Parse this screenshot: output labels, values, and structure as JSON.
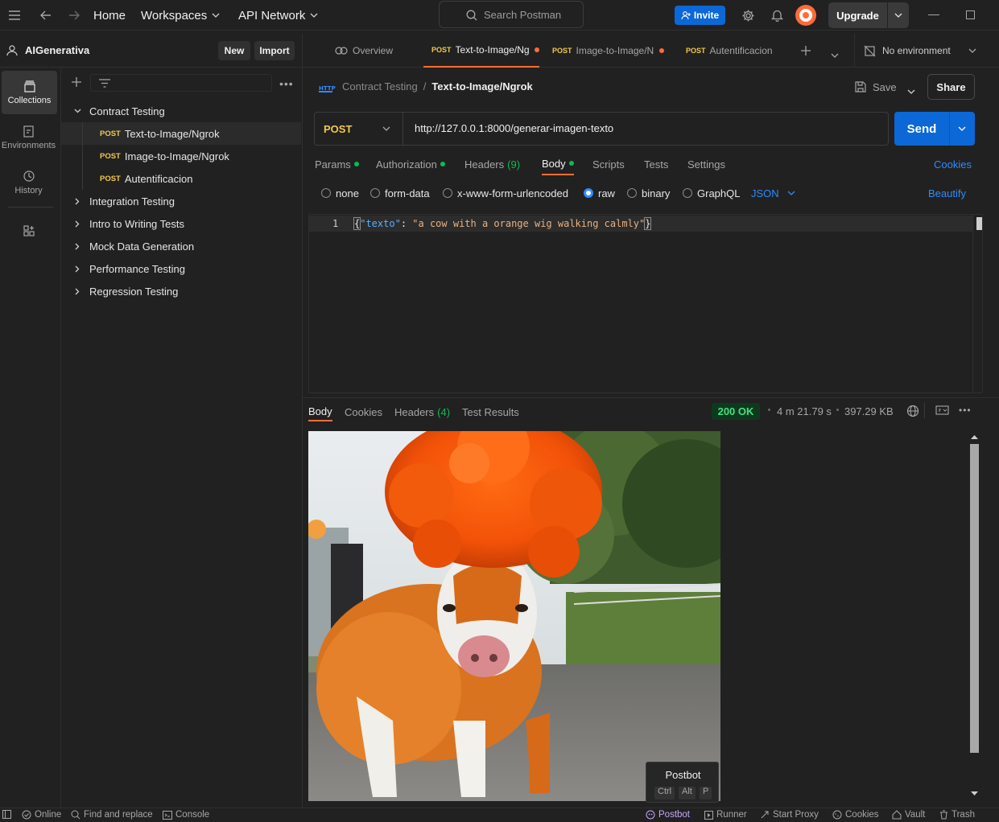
{
  "topbar": {
    "home": "Home",
    "workspaces": "Workspaces",
    "api_network": "API Network",
    "search_placeholder": "Search Postman",
    "invite": "Invite",
    "upgrade": "Upgrade"
  },
  "workspace": {
    "name": "AIGenerativa",
    "new_label": "New",
    "import_label": "Import"
  },
  "rail": {
    "collections": "Collections",
    "environments": "Environments",
    "history": "History"
  },
  "tree": {
    "method": "POST",
    "folders": [
      {
        "label": "Contract Testing",
        "expanded": true
      },
      {
        "label": "Integration Testing"
      },
      {
        "label": "Intro to Writing Tests"
      },
      {
        "label": "Mock Data Generation"
      },
      {
        "label": "Performance Testing"
      },
      {
        "label": "Regression Testing"
      }
    ],
    "requests": [
      {
        "label": "Text-to-Image/Ngrok",
        "selected": true
      },
      {
        "label": "Image-to-Image/Ngrok"
      },
      {
        "label": "Autentificacion"
      }
    ]
  },
  "tabs": {
    "overview": "Overview",
    "items": [
      {
        "method": "POST",
        "label": "Text-to-Image/Ngr",
        "active": true,
        "unsaved": true
      },
      {
        "method": "POST",
        "label": "Image-to-Image/N",
        "unsaved": true
      },
      {
        "method": "POST",
        "label": "Autentificacion"
      }
    ],
    "environment": "No environment"
  },
  "request": {
    "breadcrumb_parent": "Contract Testing",
    "breadcrumb_sep": "/",
    "title": "Text-to-Image/Ngrok",
    "save": "Save",
    "share": "Share",
    "method": "POST",
    "url": "http://127.0.0.1:8000/generar-imagen-texto",
    "send": "Send",
    "subtabs": {
      "params": "Params",
      "authorization": "Authorization",
      "headers": "Headers",
      "headers_count": "(9)",
      "body": "Body",
      "scripts": "Scripts",
      "tests": "Tests",
      "settings": "Settings",
      "cookies": "Cookies"
    },
    "body_types": {
      "none": "none",
      "form_data": "form-data",
      "urlencoded": "x-www-form-urlencoded",
      "raw": "raw",
      "binary": "binary",
      "graphql": "GraphQL",
      "format": "JSON",
      "beautify": "Beautify",
      "selected": "raw"
    },
    "editor": {
      "line_number": "1",
      "brace_open": "{",
      "key": "\"texto\"",
      "colon": ": ",
      "value": "\"a cow with a orange wig walking calmly\"",
      "brace_close": "}"
    }
  },
  "response": {
    "tabs": {
      "body": "Body",
      "cookies": "Cookies",
      "headers": "Headers",
      "headers_count": "(4)",
      "test_results": "Test Results"
    },
    "status": "200 OK",
    "time": "4 m 21.79 s",
    "size": "397.29 KB",
    "postbot": {
      "title": "Postbot",
      "keys": [
        "Ctrl",
        "Alt",
        "P"
      ]
    }
  },
  "statusbar": {
    "online": "Online",
    "find_replace": "Find and replace",
    "console": "Console",
    "postbot": "Postbot",
    "runner": "Runner",
    "start_proxy": "Start Proxy",
    "cookies": "Cookies",
    "vault": "Vault",
    "trash": "Trash"
  },
  "colors": {
    "accent": "#0b68d6",
    "post": "#f2c94c",
    "unsaved_dot": "#ff6c37",
    "ok_green": "#0cbb52"
  }
}
